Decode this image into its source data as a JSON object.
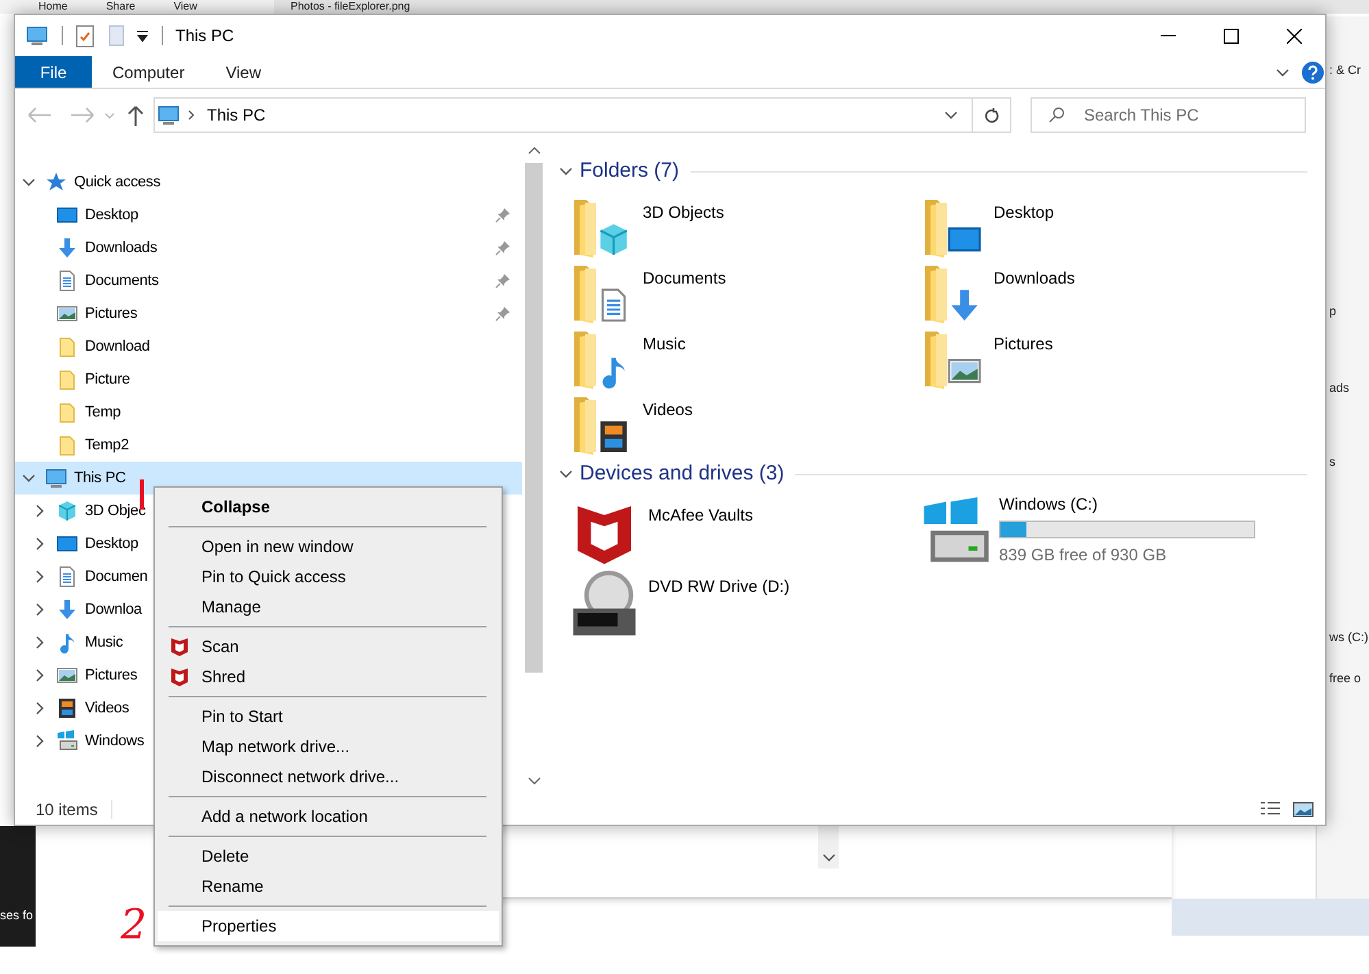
{
  "background": {
    "tabs": [
      "Home",
      "Share",
      "View"
    ],
    "photos_title": "Photos - fileExplorer.png",
    "right_fragments": [
      ": & Cr",
      "p",
      "ads",
      "s",
      "ws (C:)",
      "free o"
    ],
    "left_fragment": "ses fo"
  },
  "window": {
    "title": "This PC",
    "ribbon_tabs": [
      {
        "label": "File",
        "selected": true
      },
      {
        "label": "Computer",
        "selected": false
      },
      {
        "label": "View",
        "selected": false
      }
    ],
    "address": {
      "crumb": "This PC"
    },
    "search": {
      "placeholder": "Search This PC"
    },
    "navigation": [
      {
        "label": "Quick access",
        "kind": "star",
        "expanded": true,
        "selected": false,
        "children": [
          {
            "label": "Desktop",
            "kind": "desktop",
            "pinned": true,
            "selected": false
          },
          {
            "label": "Downloads",
            "kind": "downloads",
            "pinned": true,
            "selected": false
          },
          {
            "label": "Documents",
            "kind": "documents",
            "pinned": true,
            "selected": false
          },
          {
            "label": "Pictures",
            "kind": "pictures",
            "pinned": true,
            "selected": false
          },
          {
            "label": "Download",
            "kind": "folder",
            "pinned": false,
            "selected": false
          },
          {
            "label": "Picture",
            "kind": "folder",
            "pinned": false,
            "selected": false
          },
          {
            "label": "Temp",
            "kind": "folder",
            "pinned": false,
            "selected": false
          },
          {
            "label": "Temp2",
            "kind": "folder",
            "pinned": false,
            "selected": false
          }
        ]
      },
      {
        "label": "This PC",
        "kind": "pc",
        "expanded": true,
        "selected": true,
        "children": [
          {
            "label": "3D Objec",
            "kind": "cube",
            "expanded": false,
            "selected": false
          },
          {
            "label": "Desktop",
            "kind": "desktop",
            "expanded": false,
            "selected": false
          },
          {
            "label": "Documen",
            "kind": "documents",
            "expanded": false,
            "selected": false
          },
          {
            "label": "Downloa",
            "kind": "downloads",
            "expanded": false,
            "selected": false
          },
          {
            "label": "Music",
            "kind": "music",
            "expanded": false,
            "selected": false
          },
          {
            "label": "Pictures",
            "kind": "pictures",
            "expanded": false,
            "selected": false
          },
          {
            "label": "Videos",
            "kind": "videos",
            "expanded": false,
            "selected": false
          },
          {
            "label": "Windows",
            "kind": "windrive",
            "expanded": false,
            "selected": false
          }
        ]
      }
    ],
    "sections": [
      {
        "title": "Folders (7)",
        "expanded": true,
        "items": [
          {
            "label": "3D Objects",
            "kind": "cube"
          },
          {
            "label": "Desktop",
            "kind": "desktop"
          },
          {
            "label": "Documents",
            "kind": "documents"
          },
          {
            "label": "Downloads",
            "kind": "downloads"
          },
          {
            "label": "Music",
            "kind": "music"
          },
          {
            "label": "Pictures",
            "kind": "pictures"
          },
          {
            "label": "Videos",
            "kind": "videos"
          }
        ]
      },
      {
        "title": "Devices and drives (3)",
        "expanded": true,
        "items": [
          {
            "label": "McAfee Vaults",
            "kind": "mcafee"
          },
          {
            "label": "Windows (C:)",
            "kind": "windrive",
            "level": 0.1,
            "reading": "839 GB free of 930 GB"
          },
          {
            "label": "DVD RW Drive (D:)",
            "kind": "dvd"
          }
        ]
      }
    ],
    "status_bar": {
      "count": "10 items"
    }
  },
  "context_menu": {
    "items": [
      {
        "kind": "item",
        "label": "Collapse",
        "default": true,
        "selected": false
      },
      {
        "kind": "separator"
      },
      {
        "kind": "item",
        "label": "Open in new window",
        "selected": false
      },
      {
        "kind": "item",
        "label": "Pin to Quick access",
        "selected": false
      },
      {
        "kind": "item",
        "label": "Manage",
        "selected": false
      },
      {
        "kind": "separator"
      },
      {
        "kind": "mcafee",
        "label": "Scan",
        "selected": false
      },
      {
        "kind": "mcafee",
        "label": "Shred",
        "selected": false
      },
      {
        "kind": "separator"
      },
      {
        "kind": "item",
        "label": "Pin to Start",
        "selected": false
      },
      {
        "kind": "item",
        "label": "Map network drive...",
        "selected": false
      },
      {
        "kind": "item",
        "label": "Disconnect network drive...",
        "selected": false
      },
      {
        "kind": "separator"
      },
      {
        "kind": "item",
        "label": "Add a network location",
        "selected": false
      },
      {
        "kind": "separator"
      },
      {
        "kind": "item",
        "label": "Delete",
        "selected": false
      },
      {
        "kind": "item",
        "label": "Rename",
        "selected": false
      },
      {
        "kind": "separator"
      },
      {
        "kind": "item",
        "label": "Properties",
        "selected": true
      }
    ]
  },
  "annotations": [
    {
      "kind": "line"
    },
    {
      "kind": "text",
      "label": "2"
    }
  ]
}
